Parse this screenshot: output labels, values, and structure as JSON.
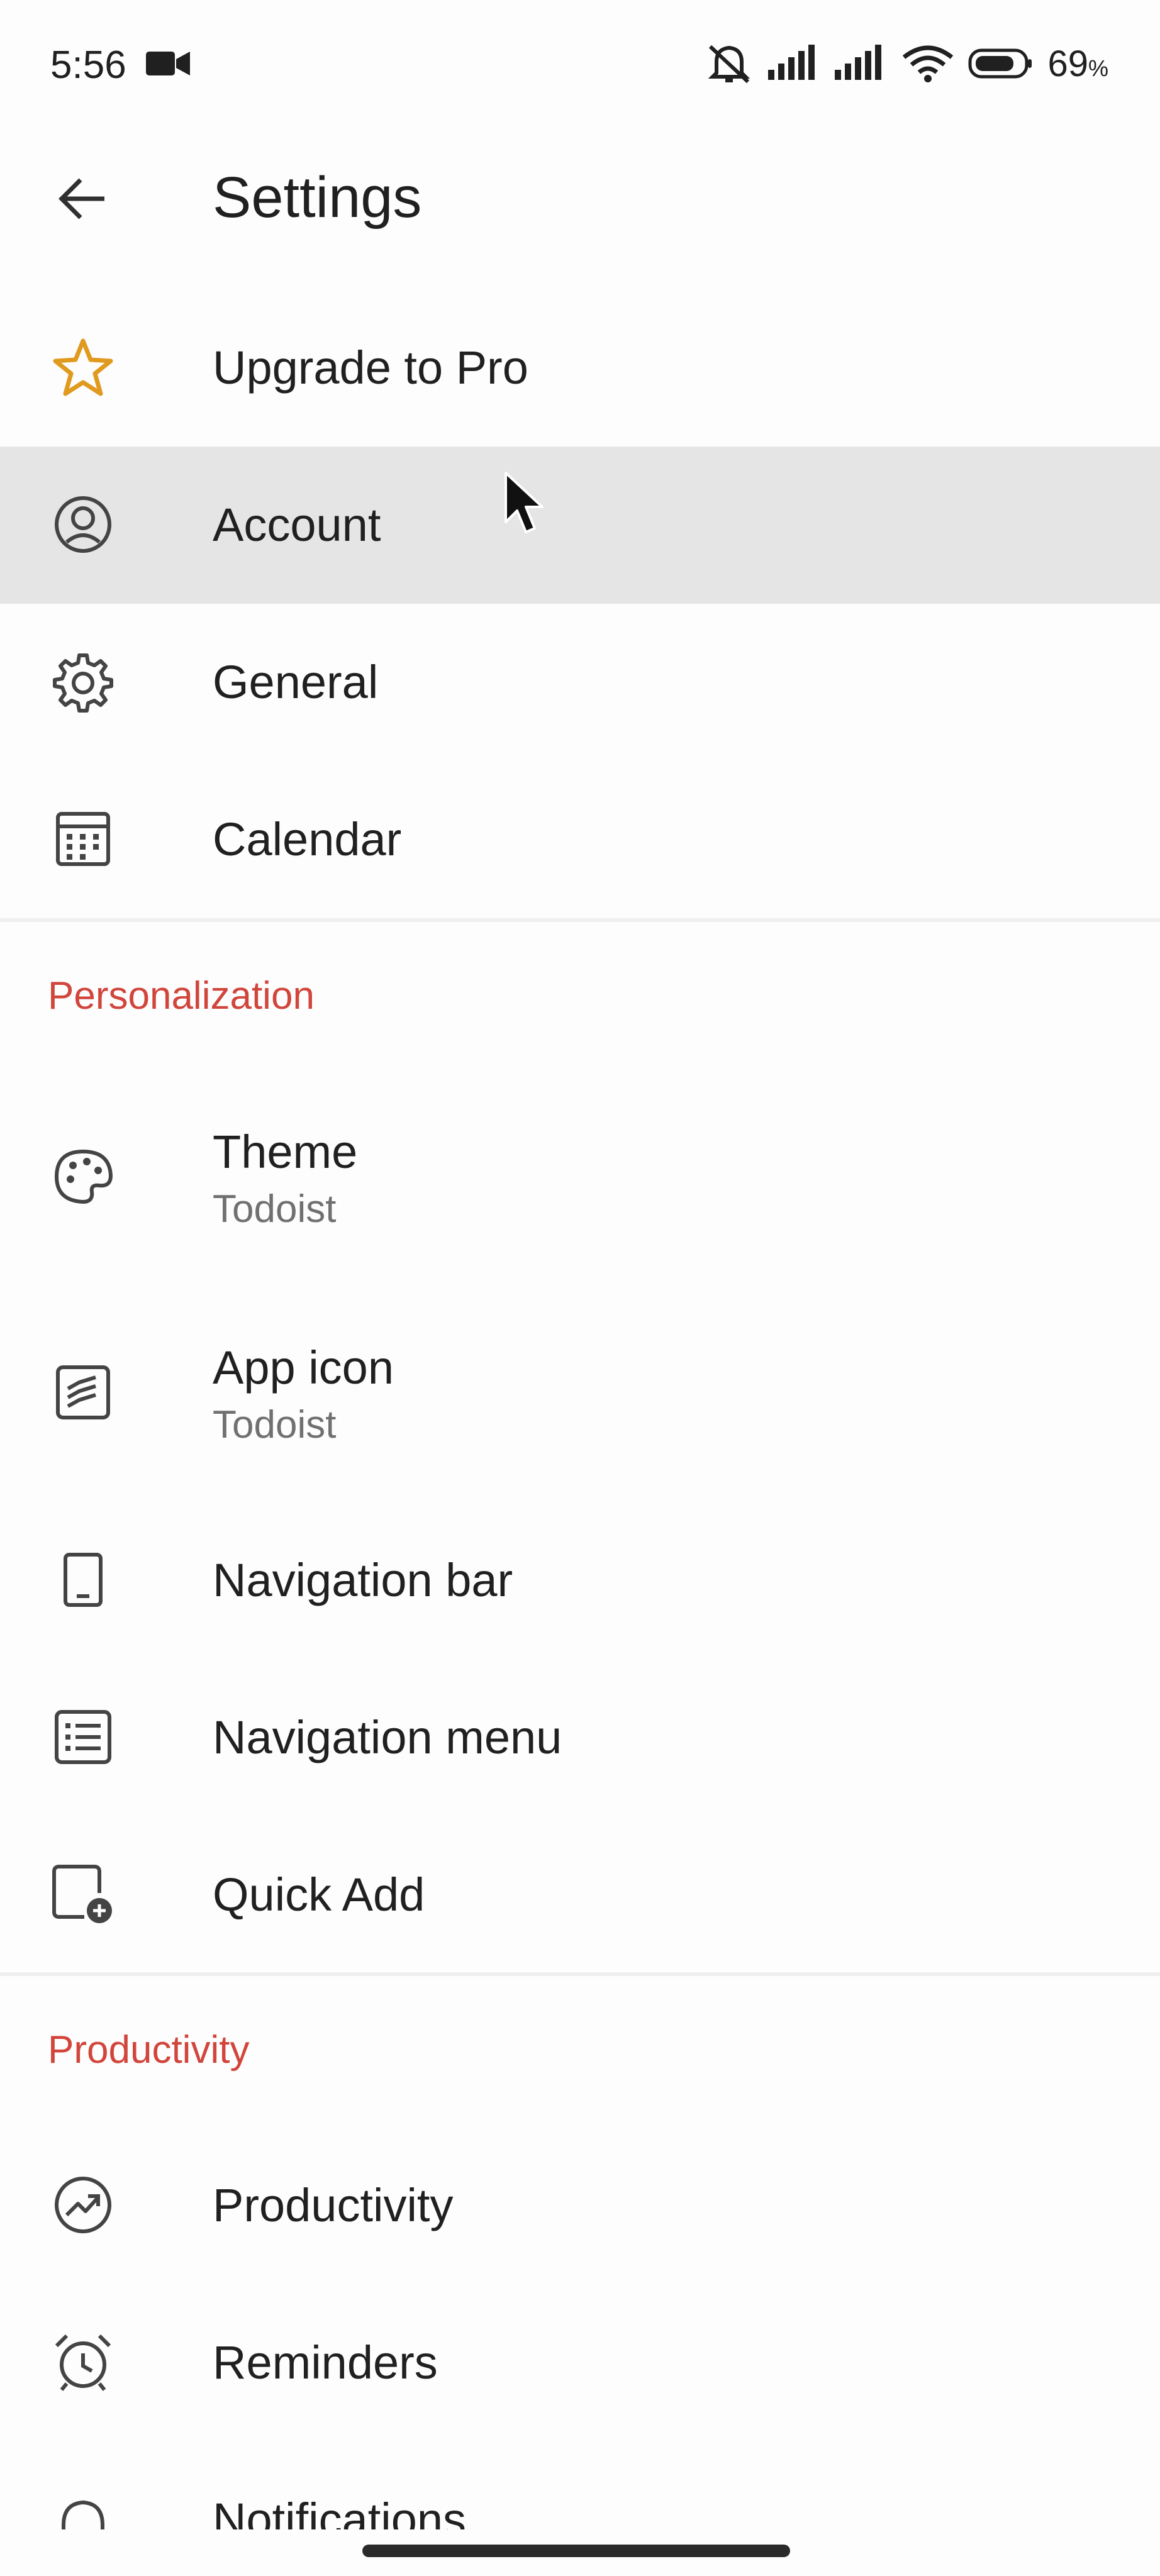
{
  "status_bar": {
    "time": "5:56",
    "battery_percent": "69",
    "battery_unit": "%",
    "icons": [
      "video-camera-icon",
      "mute-icon",
      "signal-icon",
      "signal-icon",
      "wifi-icon",
      "battery-icon"
    ]
  },
  "app_bar": {
    "title": "Settings",
    "back_icon": "arrow-left-icon"
  },
  "items": [
    {
      "label": "Upgrade to Pro",
      "icon": "star-icon"
    },
    {
      "label": "Account",
      "icon": "account-circle-icon",
      "highlighted": true
    },
    {
      "label": "General",
      "icon": "gear-icon"
    },
    {
      "label": "Calendar",
      "icon": "calendar-icon"
    }
  ],
  "sections": [
    {
      "header": "Personalization",
      "items": [
        {
          "label": "Theme",
          "subtitle": "Todoist",
          "icon": "palette-icon"
        },
        {
          "label": "App icon",
          "subtitle": "Todoist",
          "icon": "app-icon-icon"
        },
        {
          "label": "Navigation bar",
          "icon": "phone-icon"
        },
        {
          "label": "Navigation menu",
          "icon": "list-icon"
        },
        {
          "label": "Quick Add",
          "icon": "quick-add-icon"
        }
      ]
    },
    {
      "header": "Productivity",
      "items": [
        {
          "label": "Productivity",
          "icon": "trend-icon"
        },
        {
          "label": "Reminders",
          "icon": "alarm-icon"
        },
        {
          "label": "Notifications",
          "icon": "bell-icon"
        }
      ]
    }
  ],
  "colors": {
    "accent": "#d1453b",
    "star": "#e09a1e",
    "highlight": "#e5e5e5"
  }
}
